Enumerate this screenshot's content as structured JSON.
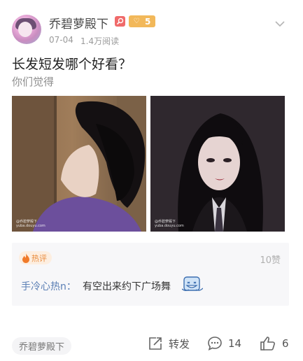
{
  "author": {
    "name": "乔碧萝殿下",
    "level": "5",
    "date": "07-04",
    "views": "1.4万阅读"
  },
  "post": {
    "title": "长发短发哪个好看？",
    "subtitle": "你们觉得",
    "images": [
      {
        "watermark": [
          "@乔碧萝殿下",
          "yuba.douyu.com"
        ]
      },
      {
        "watermark": [
          "@乔碧萝殿下",
          "yuba.douyu.com"
        ]
      }
    ]
  },
  "hot_comment": {
    "tag": "热评",
    "likes": "10赞",
    "commenter": "手冷心热n：",
    "text": "有空出来约下广场舞"
  },
  "footer": {
    "topic_tag": "乔碧萝殿下",
    "share_label": "转发",
    "comment_count": "14",
    "like_count": "6"
  },
  "colors": {
    "accent_link": "#5b7fb5",
    "hot_orange": "#e98a3b",
    "level_badge": "#f2b85a",
    "rank_badge": "#f06a6a"
  }
}
